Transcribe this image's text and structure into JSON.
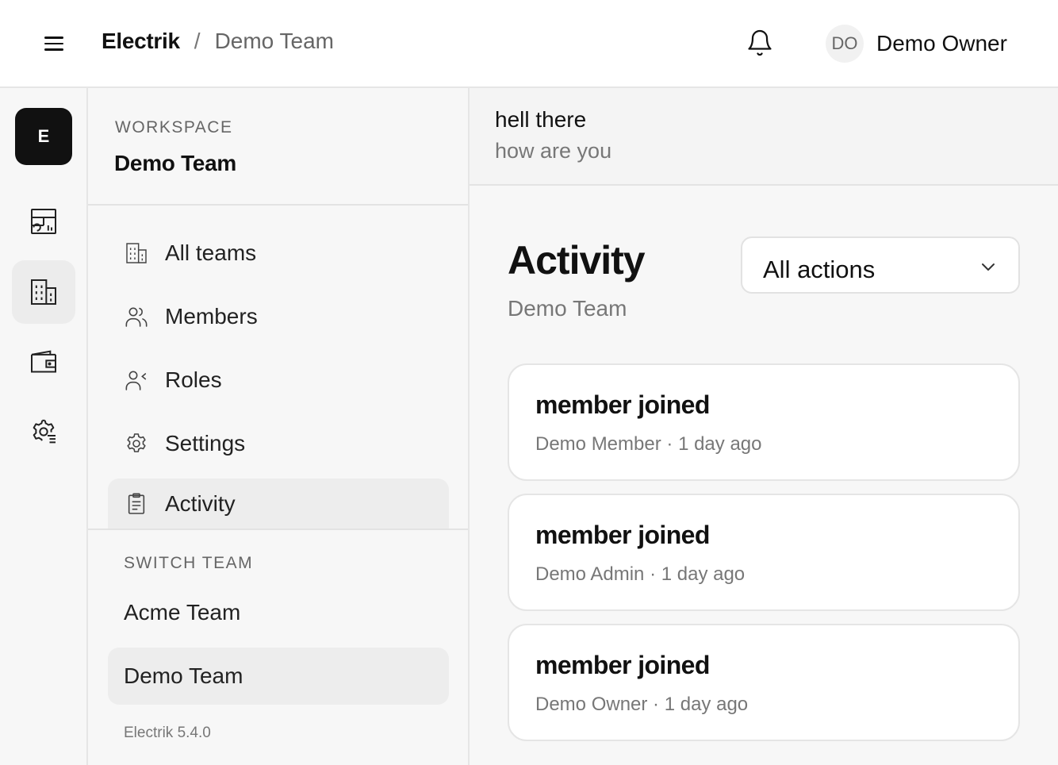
{
  "header": {
    "brand": "Electrik",
    "separator": "/",
    "current_team": "Demo Team",
    "user": {
      "initials": "DO",
      "name": "Demo Owner"
    }
  },
  "rail": {
    "logo_letter": "E",
    "icons": [
      "dashboard-chart-icon",
      "building-icon",
      "wallet-icon",
      "settings-list-icon"
    ],
    "active_index": 1
  },
  "sidebar": {
    "workspace_label": "WORKSPACE",
    "workspace_name": "Demo Team",
    "items": [
      {
        "label": "All teams",
        "icon": "building-icon"
      },
      {
        "label": "Members",
        "icon": "users-icon"
      },
      {
        "label": "Roles",
        "icon": "user-role-icon"
      },
      {
        "label": "Settings",
        "icon": "gear-icon"
      },
      {
        "label": "Activity",
        "icon": "clipboard-icon"
      }
    ],
    "active_item": "Activity",
    "switch_label": "SWITCH TEAM",
    "teams": [
      {
        "label": "Acme Team"
      },
      {
        "label": "Demo Team"
      }
    ],
    "active_team": "Demo Team",
    "version": "Electrik 5.4.0"
  },
  "banner": {
    "title": "hell there",
    "subtitle": "how are you"
  },
  "activity": {
    "title": "Activity",
    "subtitle": "Demo Team",
    "filter": {
      "selected": "All actions"
    },
    "events": [
      {
        "action": "member joined",
        "actor": "Demo Member",
        "sep": "·",
        "time": "1 day ago"
      },
      {
        "action": "member joined",
        "actor": "Demo Admin",
        "sep": "·",
        "time": "1 day ago"
      },
      {
        "action": "member joined",
        "actor": "Demo Owner",
        "sep": "·",
        "time": "1 day ago"
      }
    ]
  },
  "colors": {
    "accent": "#111111",
    "muted_text": "#777777",
    "panel_bg": "#f7f7f7",
    "active_bg": "#ededed",
    "border": "#e6e6e6"
  }
}
